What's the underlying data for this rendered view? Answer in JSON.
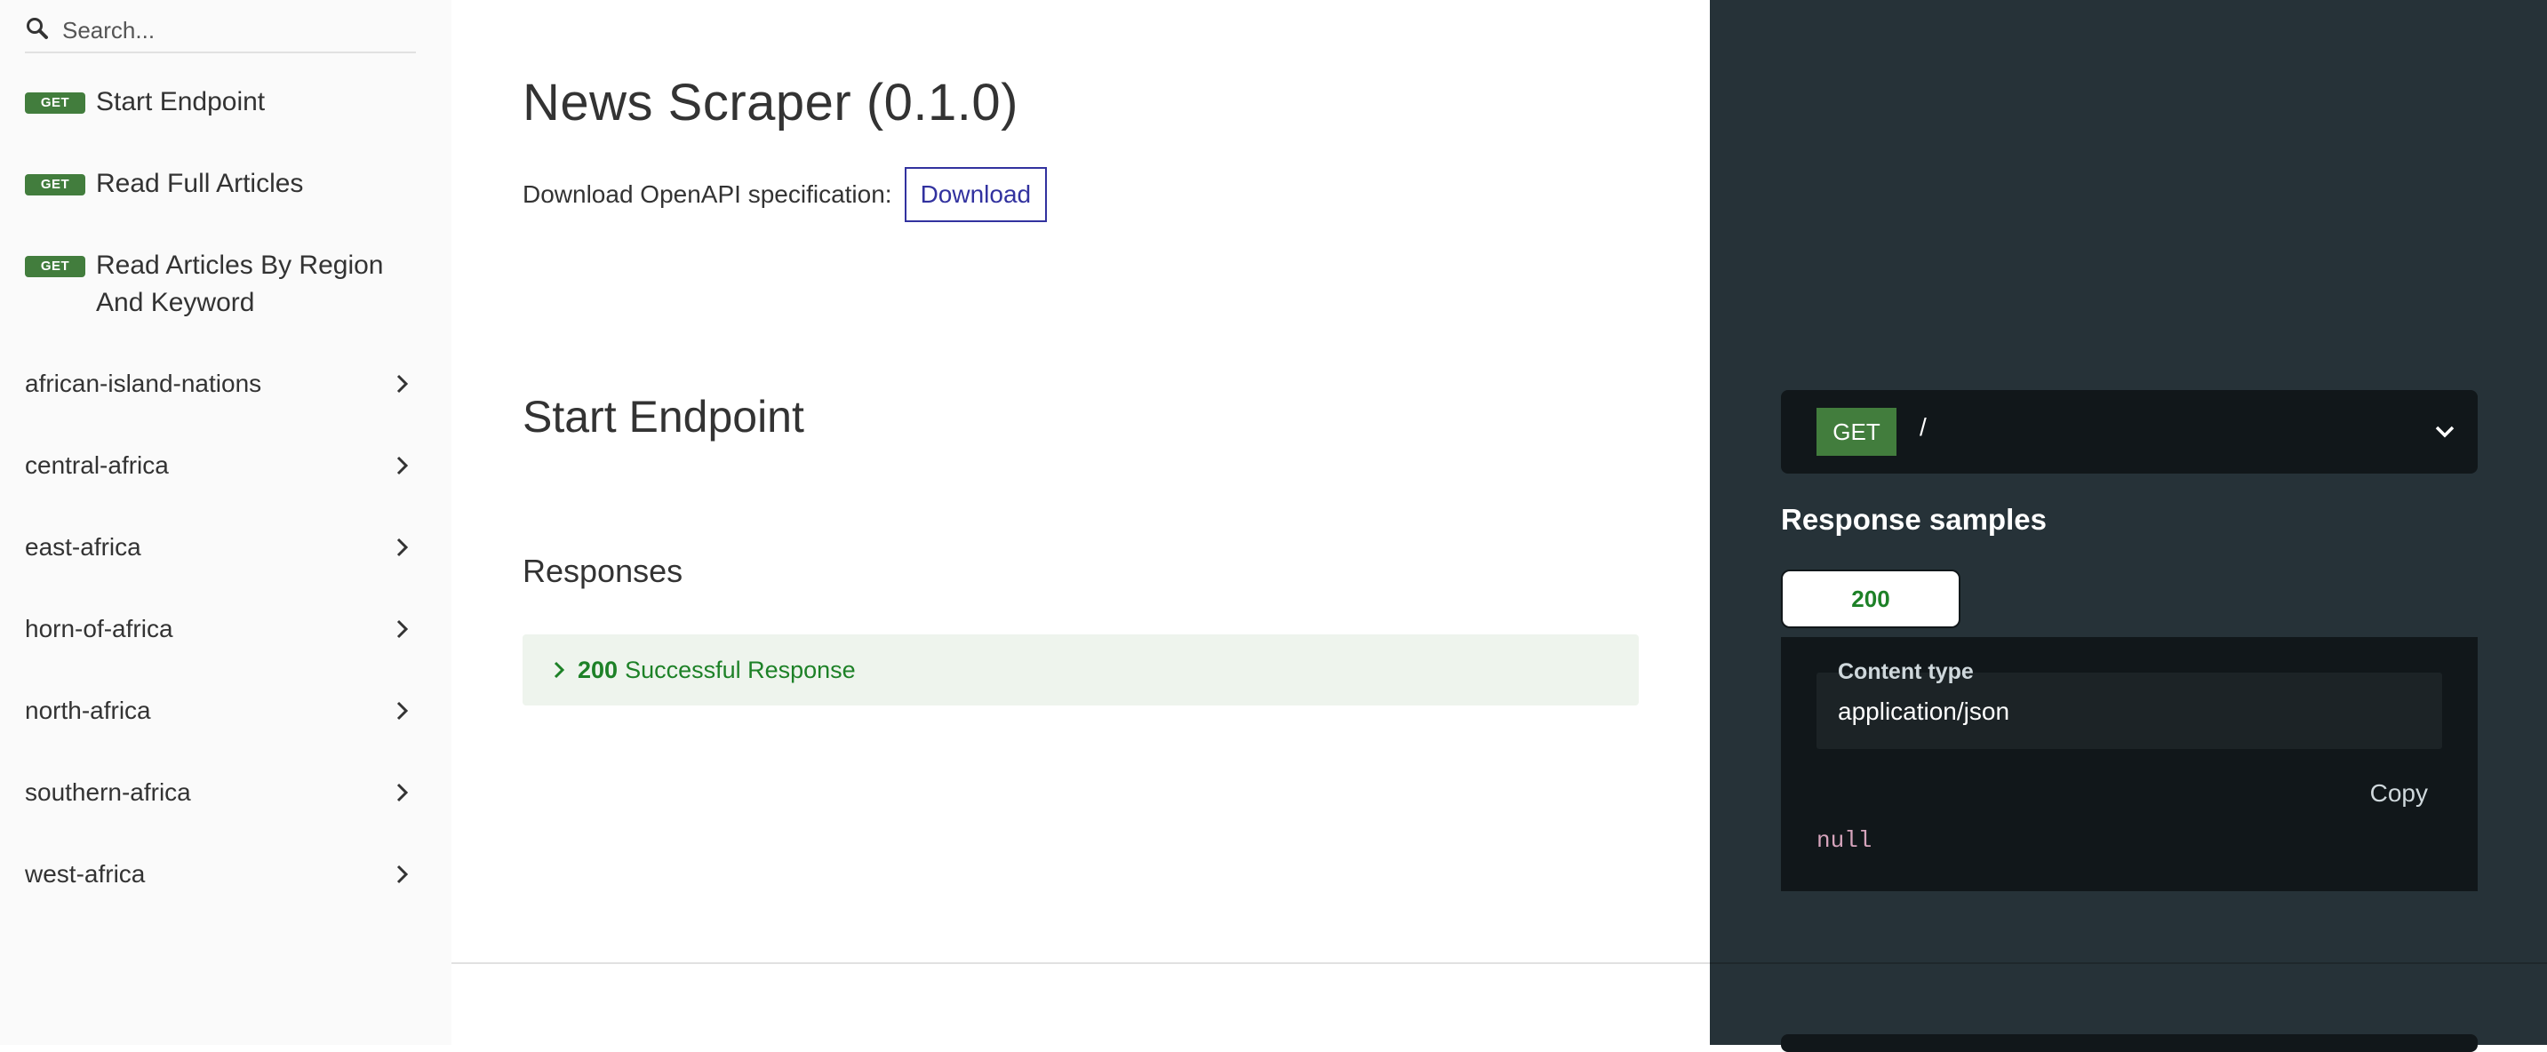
{
  "sidebar": {
    "search": {
      "placeholder": "Search...",
      "value": ""
    },
    "operations": [
      {
        "method": "GET",
        "label": "Start Endpoint"
      },
      {
        "method": "GET",
        "label": "Read Full Articles"
      },
      {
        "method": "GET",
        "label": "Read Articles By Region And Keyword"
      }
    ],
    "tags": [
      "african-island-nations",
      "central-africa",
      "east-africa",
      "horn-of-africa",
      "north-africa",
      "southern-africa",
      "west-africa"
    ]
  },
  "main": {
    "title": "News Scraper (0.1.0)",
    "download_text": "Download OpenAPI specification:",
    "download_label": "Download",
    "section_title": "Start Endpoint",
    "responses_title": "Responses",
    "responses": [
      {
        "code": "200",
        "description": "Successful Response"
      }
    ]
  },
  "right_panel": {
    "method": "GET",
    "path": "/",
    "samples_title": "Response samples",
    "tab_label": "200",
    "content_type_label": "Content type",
    "content_type_value": "application/json",
    "copy_label": "Copy",
    "sample_body": "null"
  },
  "colors": {
    "get_badge": "#427d3d",
    "right_panel_bg": "#263238",
    "code_block_bg": "#11171a",
    "success_text": "#1d8127",
    "success_bg": "#eef4ed",
    "link": "#32329f"
  }
}
